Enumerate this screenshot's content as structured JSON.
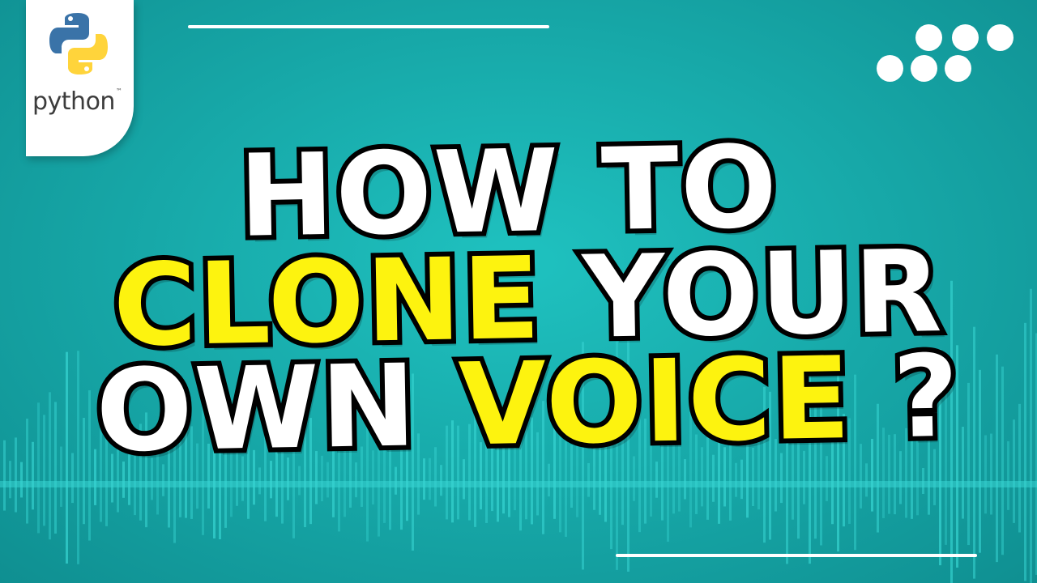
{
  "colors": {
    "background_center": "#1fc2c0",
    "background_edge": "#0f8f91",
    "waveform": "#38d6d3",
    "line": "#ffffff",
    "logo_card": "#ffffff",
    "python_blue": "#3a73a8",
    "python_yellow": "#ffd43b",
    "dot": "#ffffff",
    "text_white": "#ffffff",
    "text_yellow": "#fdf30f",
    "text_outline": "#000000"
  },
  "logo": {
    "icon": "python-logo-icon",
    "wordmark": "python",
    "trademark": "™"
  },
  "headline": {
    "line1": [
      {
        "text": "HOW",
        "color": "white"
      },
      {
        "text": "TO",
        "color": "white"
      }
    ],
    "line2": [
      {
        "text": "CLONE",
        "color": "yellow"
      },
      {
        "text": "YOUR",
        "color": "white"
      }
    ],
    "line3": [
      {
        "text": "OWN",
        "color": "white"
      },
      {
        "text": "VOICE",
        "color": "yellow"
      },
      {
        "text": "?",
        "color": "white"
      }
    ]
  },
  "decorations": {
    "dots_icon": "dot-grid-icon",
    "waveform_icon": "audio-waveform-icon"
  }
}
